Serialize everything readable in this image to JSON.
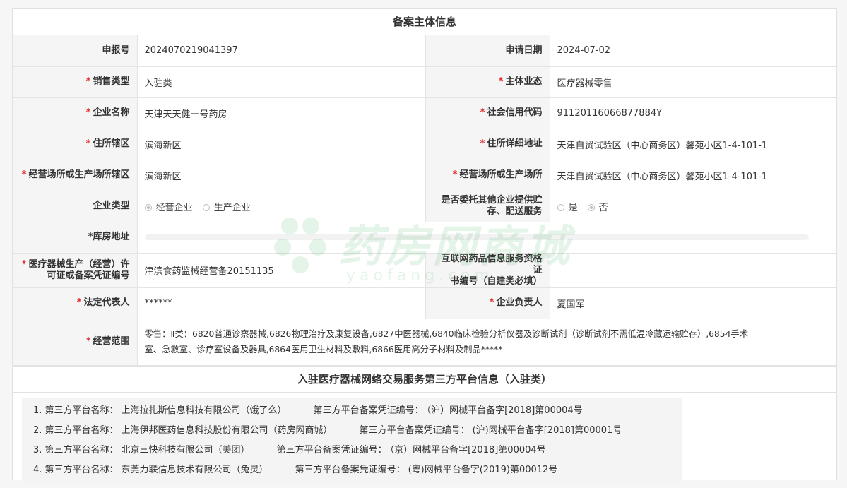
{
  "section1_title": "备案主体信息",
  "rows": {
    "report_no": {
      "label": "申报号",
      "value": "2024070219041397"
    },
    "apply_date": {
      "label": "申请日期",
      "value": "2024-07-02"
    },
    "sales_type": {
      "label": "销售类型",
      "value": "入驻类"
    },
    "business_form": {
      "label": "主体业态",
      "value": "医疗器械零售"
    },
    "company_name": {
      "label": "企业名称",
      "value": "天津天天健一号药房"
    },
    "credit_code": {
      "label": "社会信用代码",
      "value": "91120116066877884Y"
    },
    "residence_district": {
      "label": "住所辖区",
      "value": "滨海新区"
    },
    "residence_address": {
      "label": "住所详细地址",
      "value": "天津自贸试验区（中心商务区）馨苑小区1-4-101-1"
    },
    "premises_district": {
      "label": "经营场所或生产场所辖区",
      "value": "滨海新区"
    },
    "premises_address": {
      "label": "经营场所或生产场所",
      "value": "天津自贸试验区（中心商务区）馨苑小区1-4-101-1"
    },
    "enterprise_type": {
      "label": "企业类型",
      "options": [
        "经营企业",
        "生产企业"
      ],
      "selected": "经营企业"
    },
    "entrust_storage": {
      "label_line1": "是否委托其他企业提供贮",
      "label_line2": "存、配送服务",
      "options": [
        "是",
        "否"
      ],
      "selected": "否"
    },
    "warehouse_address": {
      "label": "*库房地址",
      "value": ""
    },
    "license_no": {
      "label_line1": "医疗器械生产（经营）许",
      "label_line2": "可证或备案凭证编号",
      "value": "津滨食药监械经营备20151135"
    },
    "internet_cert": {
      "label_line1": "互联网药品信息服务资格证",
      "label_line2": "书编号（自建类必填）",
      "value": ""
    },
    "legal_rep": {
      "label": "法定代表人",
      "value": "******"
    },
    "principal": {
      "label": "企业负责人",
      "value": "夏国军"
    },
    "scope": {
      "label": "经营范围",
      "line1": "零售：Ⅱ类：6820普通诊察器械,6826物理治疗及康复设备,6827中医器械,6840临床检验分析仪器及诊断试剂（诊断试剂不需低温冷藏运输贮存）,6854手术",
      "line2": "室、急救室、诊疗室设备及器具,6864医用卫生材料及敷料,6866医用高分子材料及制品*****"
    }
  },
  "section2_title": "入驻医疗器械网络交易服务第三方平台信息（入驻类）",
  "platforms": [
    {
      "name_label": "1. 第三方平台名称：",
      "name": "上海拉扎斯信息科技有限公司（饿了么）",
      "cert_label": "第三方平台备案凭证编号：",
      "cert": "（沪）网械平台备字[2018]第00004号"
    },
    {
      "name_label": "2. 第三方平台名称：",
      "name": "上海伊邦医药信息科技股份有限公司（药房网商城）",
      "cert_label": "第三方平台备案凭证编号：",
      "cert": "(沪)网械平台备字[2018]第00001号"
    },
    {
      "name_label": "3. 第三方平台名称：",
      "name": "北京三快科技有限公司（美团）",
      "cert_label": "第三方平台备案凭证编号：",
      "cert": "（京）网械平台备字[2018]第00004号"
    },
    {
      "name_label": "4. 第三方平台名称：",
      "name": "东莞力联信息技术有限公司（兔灵）",
      "cert_label": "第三方平台备案凭证编号：",
      "cert": "(粤)网械平台备字(2019)第00012号"
    }
  ],
  "watermark": {
    "text": "药房网商城",
    "sub": "yaofang.com"
  },
  "colors": {
    "required": "#e52d2d",
    "label_bg": "#f5f5f5",
    "border": "#e4e4e4"
  }
}
